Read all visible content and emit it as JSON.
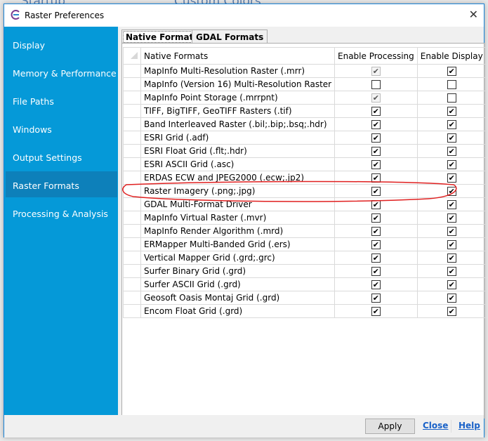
{
  "background": {
    "items": [
      "Startup",
      "Custom Colors"
    ]
  },
  "window": {
    "title": "Raster Preferences"
  },
  "sidebar": {
    "items": [
      {
        "label": "Display"
      },
      {
        "label": "Memory & Performance"
      },
      {
        "label": "File Paths"
      },
      {
        "label": "Windows"
      },
      {
        "label": "Output Settings"
      },
      {
        "label": "Raster Formats",
        "selected": true
      },
      {
        "label": "Processing & Analysis"
      }
    ]
  },
  "tabs": [
    {
      "label": "Native Formats",
      "active": true
    },
    {
      "label": "GDAL Formats"
    }
  ],
  "table": {
    "headers": [
      "Native Formats",
      "Enable Processing",
      "Enable Display"
    ],
    "rows": [
      {
        "name": "MapInfo Multi-Resolution Raster (.mrr)",
        "processing": true,
        "processing_disabled": true,
        "display": true
      },
      {
        "name": "MapInfo (Version 16) Multi-Resolution Raster (.mrr)",
        "processing": false,
        "display": false
      },
      {
        "name": "MapInfo Point Storage (.mrrpnt)",
        "processing": true,
        "processing_disabled": true,
        "display": false
      },
      {
        "name": "TIFF, BigTIFF, GeoTIFF Rasters (.tif)",
        "processing": true,
        "display": true
      },
      {
        "name": "Band Interleaved Raster (.bil;.bip;.bsq;.hdr)",
        "processing": true,
        "display": true
      },
      {
        "name": "ESRI Grid (.adf)",
        "processing": true,
        "display": true
      },
      {
        "name": "ESRI Float Grid (.flt;.hdr)",
        "processing": true,
        "display": true
      },
      {
        "name": "ESRI ASCII Grid (.asc)",
        "processing": true,
        "display": true
      },
      {
        "name": "ERDAS ECW and JPEG2000 (.ecw;.jp2)",
        "processing": true,
        "display": true
      },
      {
        "name": "Raster Imagery (.png;.jpg)",
        "processing": true,
        "display": true,
        "highlighted": true
      },
      {
        "name": "GDAL Multi-Format Driver",
        "processing": true,
        "display": true
      },
      {
        "name": "MapInfo Virtual Raster (.mvr)",
        "processing": true,
        "display": true
      },
      {
        "name": "MapInfo Render Algorithm (.mrd)",
        "processing": true,
        "display": true
      },
      {
        "name": "ERMapper Multi-Banded Grid (.ers)",
        "processing": true,
        "display": true
      },
      {
        "name": "Vertical Mapper Grid (.grd;.grc)",
        "processing": true,
        "display": true
      },
      {
        "name": "Surfer Binary Grid (.grd)",
        "processing": true,
        "display": true
      },
      {
        "name": "Surfer ASCII Grid (.grd)",
        "processing": true,
        "display": true
      },
      {
        "name": "Geosoft Oasis Montaj Grid (.grd)",
        "processing": true,
        "display": true
      },
      {
        "name": "Encom Float Grid (.grd)",
        "processing": true,
        "display": true
      }
    ]
  },
  "footer": {
    "apply": "Apply",
    "close": "Close",
    "help": "Help"
  },
  "colors": {
    "sidebar": "#0599d8",
    "sidebar_selected": "#0d80ba",
    "annotation": "#e02020",
    "link": "#1a62c8"
  }
}
